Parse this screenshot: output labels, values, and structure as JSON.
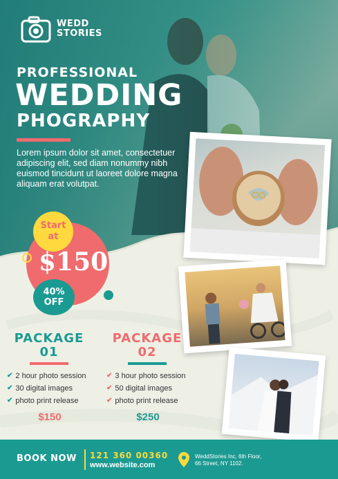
{
  "brand": {
    "line1": "WEDD",
    "line2": "STORIES",
    "icon": "camera-icon"
  },
  "headline": {
    "line1": "PROFESSIONAL",
    "line2": "WEDDING",
    "line3": "PHOGRAPHY"
  },
  "body": "Lorem ipsum dolor sit amet, consectetuer adipiscing elit, sed diam nonummy nibh euismod tincidunt ut laoreet dolore magna aliquam erat volutpat.",
  "promo": {
    "start_line1": "Start",
    "start_line2": "at",
    "price": "$150",
    "discount_line1": "40%",
    "discount_line2": "OFF"
  },
  "packages": [
    {
      "title_line1": "PACKAGE",
      "title_line2": "01",
      "features": [
        "2 hour photo session",
        "30 digital images",
        "photo print release"
      ],
      "price": "$150"
    },
    {
      "title_line1": "PACKAGE",
      "title_line2": "02",
      "features": [
        "3 hour photo session",
        "50 digital images",
        "photo print release"
      ],
      "price": "$250"
    }
  ],
  "footer": {
    "cta": "BOOK NOW",
    "phone": "121 360 00360",
    "website": "www.website.com",
    "address_line1": "WeddStories Inc, 6th Floor,",
    "address_line2": "66 Street, NY 1102.",
    "address_icon": "map-pin-icon"
  },
  "colors": {
    "teal": "#1b9a92",
    "coral": "#f06b6d",
    "yellow": "#ffd93d",
    "cream": "#eef0e6"
  }
}
